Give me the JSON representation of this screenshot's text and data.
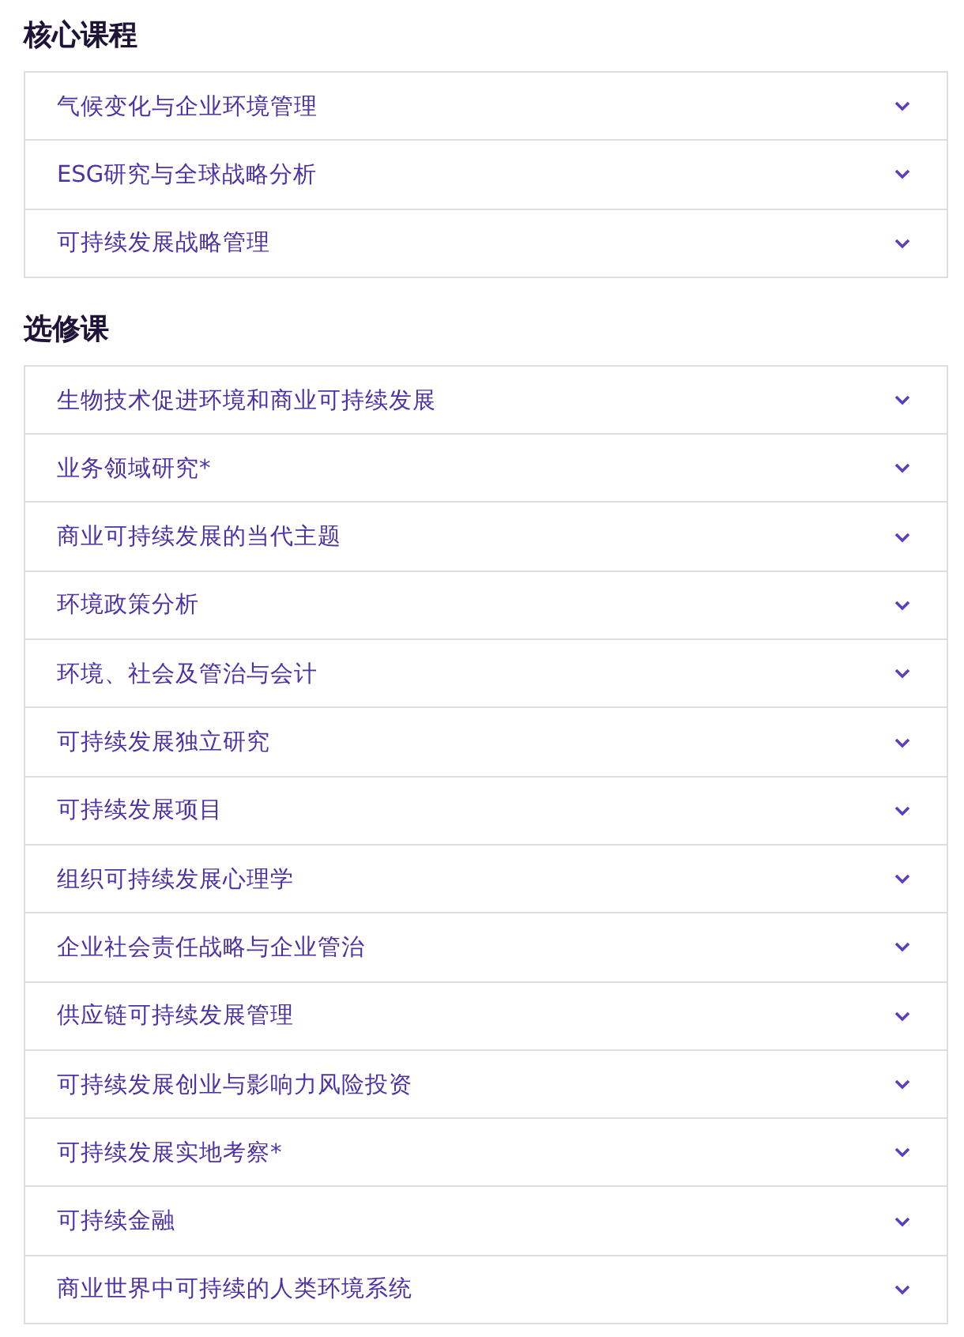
{
  "sections": [
    {
      "title": "核心课程",
      "items": [
        {
          "label": "气候变化与企业环境管理",
          "expanded": false
        },
        {
          "label": "ESG研究与全球战略分析",
          "expanded": false
        },
        {
          "label": "可持续发展战略管理",
          "expanded": false
        }
      ]
    },
    {
      "title": "选修课",
      "items": [
        {
          "label": "生物技术促进环境和商业可持续发展",
          "expanded": false
        },
        {
          "label": "业务领域研究*",
          "expanded": false
        },
        {
          "label": "商业可持续发展的当代主题",
          "expanded": false
        },
        {
          "label": "环境政策分析",
          "expanded": false
        },
        {
          "label": "环境、社会及管治与会计",
          "expanded": false
        },
        {
          "label": "可持续发展独立研究",
          "expanded": false
        },
        {
          "label": "可持续发展项目",
          "expanded": false
        },
        {
          "label": "组织可持续发展心理学",
          "expanded": false
        },
        {
          "label": "企业社会责任战略与企业管治",
          "expanded": false
        },
        {
          "label": "供应链可持续发展管理",
          "expanded": false
        },
        {
          "label": "可持续发展创业与影响力风险投资",
          "expanded": false
        },
        {
          "label": "可持续发展实地考察*",
          "expanded": false
        },
        {
          "label": "可持续金融",
          "expanded": false
        },
        {
          "label": "商业世界中可持续的人类环境系统",
          "expanded": false
        }
      ]
    }
  ]
}
